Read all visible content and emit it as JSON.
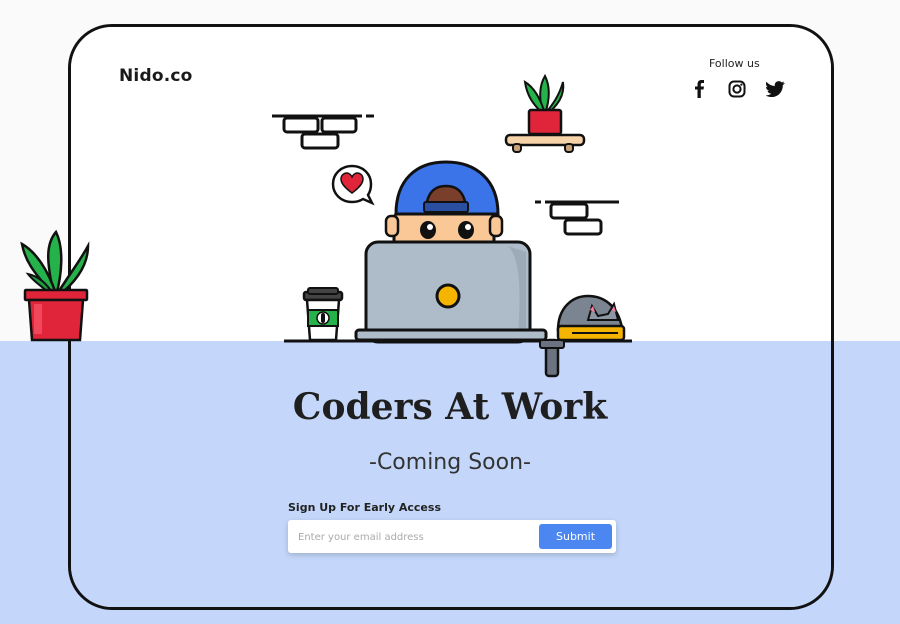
{
  "brand": {
    "name": "Nido.co"
  },
  "social": {
    "label": "Follow us",
    "icons": [
      "facebook-icon",
      "instagram-icon",
      "twitter-icon"
    ]
  },
  "hero": {
    "title": "Coders At Work",
    "subtitle": "-Coming Soon-"
  },
  "signup": {
    "label": "Sign Up For Early Access",
    "email_placeholder": "Enter your email address",
    "submit_label": "Submit"
  },
  "colors": {
    "accent": "#4c86f0",
    "lower_background": "#c4d7fa",
    "upper_background": "#ffffff",
    "plant_pot": "#e0243a",
    "plant_leaf": "#25b24a",
    "cap": "#3b74e8"
  }
}
